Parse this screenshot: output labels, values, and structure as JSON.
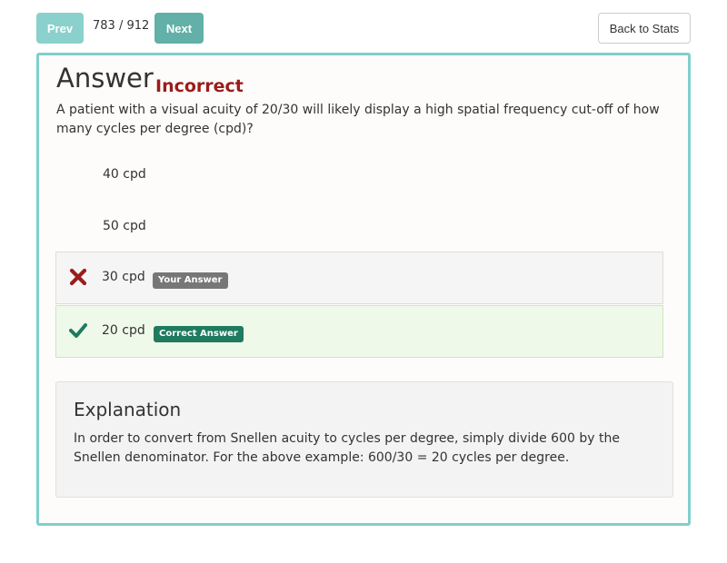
{
  "nav": {
    "prev_label": "Prev",
    "counter": "783 / 912",
    "next_label": "Next",
    "back_label": "Back to Stats"
  },
  "answer": {
    "title": "Answer",
    "status": "Incorrect",
    "question": "A patient with a visual acuity of 20/30 will likely display a high spatial frequency cut-off of how many cycles per degree (cpd)?"
  },
  "options": [
    {
      "label": "40 cpd"
    },
    {
      "label": "50 cpd"
    },
    {
      "label": "30 cpd",
      "badge": "Your Answer",
      "icon": "cross-icon"
    },
    {
      "label": "20 cpd",
      "badge": "Correct Answer",
      "icon": "checkmark-icon"
    }
  ],
  "explanation": {
    "title": "Explanation",
    "text": "In order to convert from Snellen acuity to cycles per degree, simply divide 600 by the Snellen denominator. For the above example: 600/30 = 20 cycles per degree."
  },
  "colors": {
    "accent_border": "#80cfcb",
    "incorrect": "#9b1c1c",
    "correct_badge": "#1e7b5f",
    "your_answer_badge": "#777777"
  }
}
